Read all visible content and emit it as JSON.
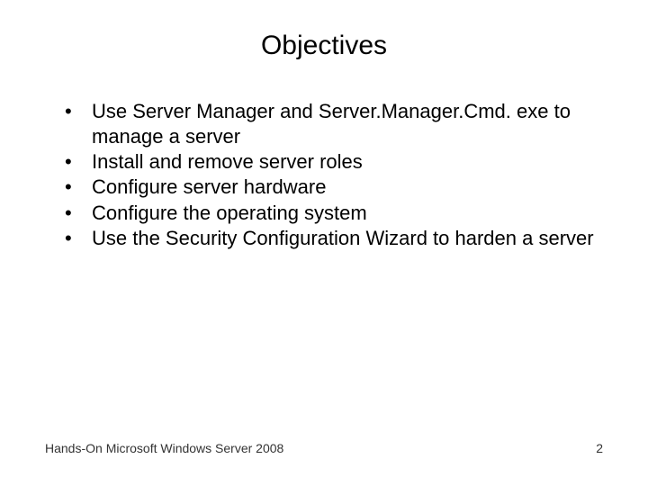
{
  "title": "Objectives",
  "bullets": {
    "b0": "Use Server Manager and Server.Manager.Cmd. exe to manage a server",
    "b1": "Install and remove server roles",
    "b2": "Configure server hardware",
    "b3": "Configure the operating system",
    "b4": "Use the Security Configuration Wizard to harden a server"
  },
  "footer": {
    "text": "Hands-On Microsoft Windows Server 2008",
    "page": "2"
  }
}
